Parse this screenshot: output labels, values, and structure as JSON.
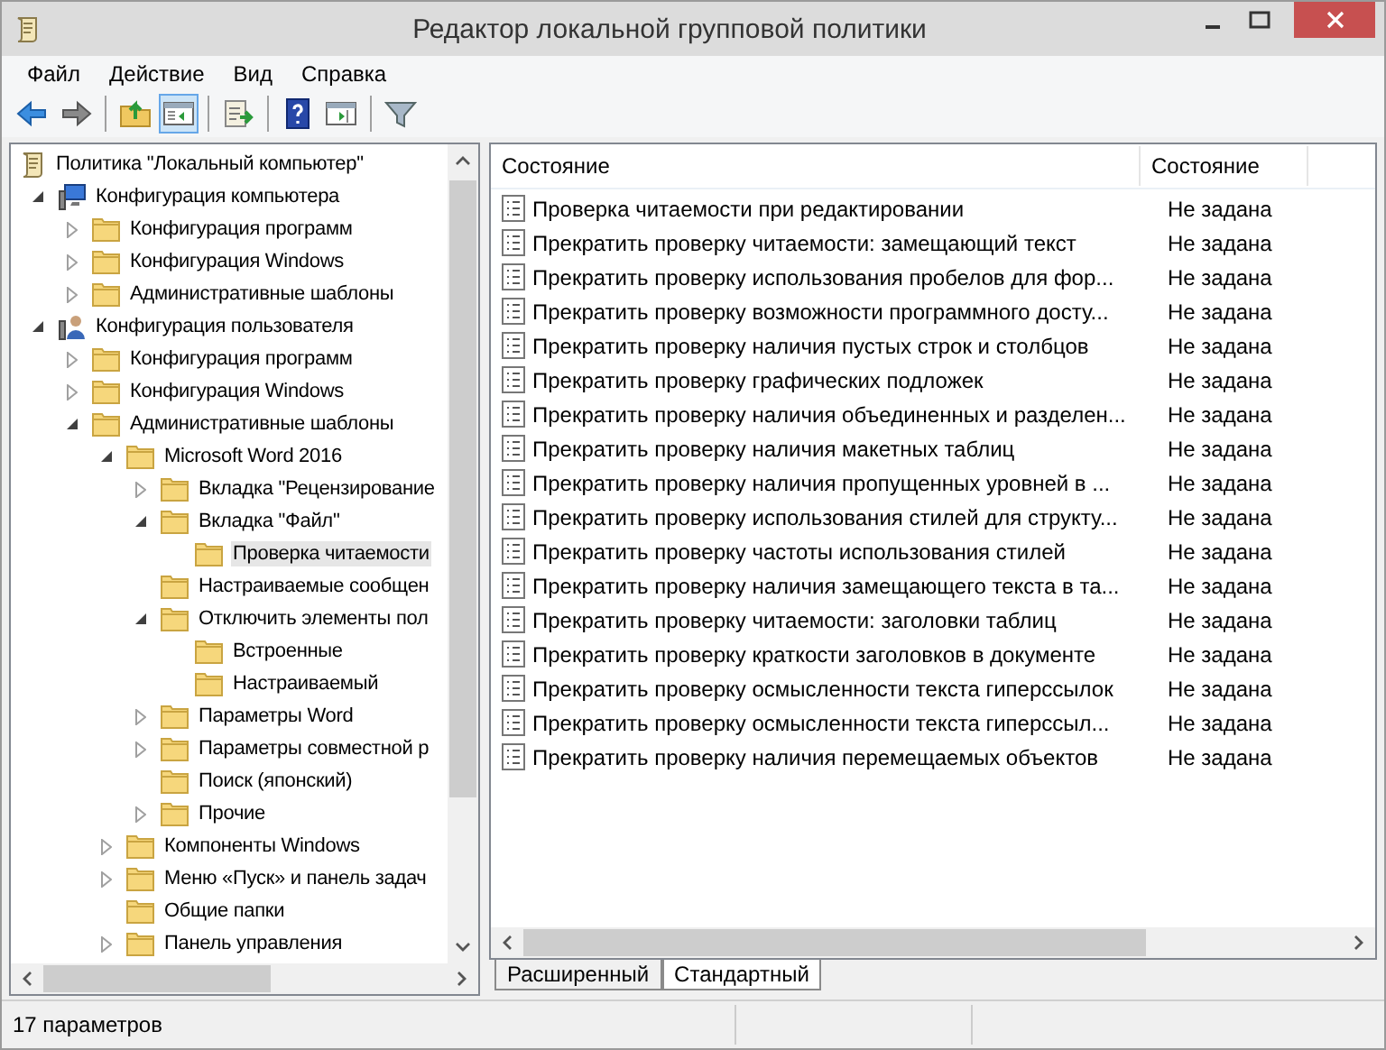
{
  "window": {
    "title": "Редактор локальной групповой политики"
  },
  "menu": [
    "Файл",
    "Действие",
    "Вид",
    "Справка"
  ],
  "toolbar": [
    [
      {
        "kind": "back",
        "pressed": false
      },
      {
        "kind": "forward",
        "pressed": false
      }
    ],
    [
      {
        "kind": "up",
        "pressed": false
      },
      {
        "kind": "tree",
        "pressed": true
      }
    ],
    [
      {
        "kind": "export",
        "pressed": false
      }
    ],
    [
      {
        "kind": "help",
        "pressed": false
      },
      {
        "kind": "pane",
        "pressed": false
      }
    ],
    [
      {
        "kind": "filter",
        "pressed": false
      }
    ]
  ],
  "tree": [
    {
      "label": "Политика \"Локальный компьютер\"",
      "kind": "policy",
      "selected": false,
      "children": [
        {
          "label": "Конфигурация компьютера",
          "kind": "computer",
          "expanded": true,
          "selected": false,
          "children": [
            {
              "label": "Конфигурация программ",
              "kind": "folder",
              "expanded": false,
              "selected": false
            },
            {
              "label": "Конфигурация Windows",
              "kind": "folder",
              "expanded": false,
              "selected": false
            },
            {
              "label": "Административные шаблоны",
              "kind": "folder",
              "expanded": false,
              "selected": false
            }
          ]
        },
        {
          "label": "Конфигурация пользователя",
          "kind": "user",
          "expanded": true,
          "selected": false,
          "children": [
            {
              "label": "Конфигурация программ",
              "kind": "folder",
              "expanded": false,
              "selected": false
            },
            {
              "label": "Конфигурация Windows",
              "kind": "folder",
              "expanded": false,
              "selected": false
            },
            {
              "label": "Административные шаблоны",
              "kind": "folder",
              "expanded": true,
              "selected": false,
              "children": [
                {
                  "label": "Microsoft Word 2016",
                  "kind": "folder",
                  "expanded": true,
                  "selected": false,
                  "children": [
                    {
                      "label": "Вкладка \"Рецензирование",
                      "kind": "folder",
                      "expanded": false,
                      "selected": false
                    },
                    {
                      "label": "Вкладка \"Файл\"",
                      "kind": "folder",
                      "expanded": true,
                      "selected": false,
                      "children": [
                        {
                          "label": "Проверка читаемости",
                          "kind": "folder",
                          "selected": true
                        }
                      ]
                    },
                    {
                      "label": "Настраиваемые сообщен",
                      "kind": "folder",
                      "selected": false
                    },
                    {
                      "label": "Отключить элементы пол",
                      "kind": "folder",
                      "expanded": true,
                      "selected": false,
                      "children": [
                        {
                          "label": "Встроенные",
                          "kind": "folder",
                          "selected": false
                        },
                        {
                          "label": "Настраиваемый",
                          "kind": "folder",
                          "selected": false
                        }
                      ]
                    },
                    {
                      "label": "Параметры Word",
                      "kind": "folder",
                      "expanded": false,
                      "selected": false
                    },
                    {
                      "label": "Параметры совместной р",
                      "kind": "folder",
                      "expanded": false,
                      "selected": false
                    },
                    {
                      "label": "Поиск (японский)",
                      "kind": "folder",
                      "selected": false
                    },
                    {
                      "label": "Прочие",
                      "kind": "folder",
                      "expanded": false,
                      "selected": false
                    }
                  ]
                },
                {
                  "label": "Компоненты Windows",
                  "kind": "folder",
                  "expanded": false,
                  "selected": false
                },
                {
                  "label": "Меню «Пуск» и панель задач",
                  "kind": "folder",
                  "expanded": false,
                  "selected": false
                },
                {
                  "label": "Общие папки",
                  "kind": "folder",
                  "selected": false
                },
                {
                  "label": "Панель управления",
                  "kind": "folder",
                  "expanded": false,
                  "selected": false
                }
              ]
            }
          ]
        }
      ]
    }
  ],
  "table": {
    "columns": [
      "Состояние",
      "Состояние"
    ],
    "rows": [
      [
        "Проверка читаемости при редактировании",
        "Не задана"
      ],
      [
        "Прекратить проверку читаемости: замещающий текст",
        "Не задана"
      ],
      [
        "Прекратить проверку использования пробелов для фор...",
        "Не задана"
      ],
      [
        "Прекратить проверку возможности программного досту...",
        "Не задана"
      ],
      [
        "Прекратить проверку наличия пустых строк и столбцов",
        "Не задана"
      ],
      [
        "Прекратить проверку графических подложек",
        "Не задана"
      ],
      [
        "Прекратить проверку наличия объединенных и разделен...",
        "Не задана"
      ],
      [
        "Прекратить проверку наличия макетных таблиц",
        "Не задана"
      ],
      [
        "Прекратить проверку наличия пропущенных уровней в ...",
        "Не задана"
      ],
      [
        "Прекратить проверку использования стилей для структу...",
        "Не задана"
      ],
      [
        "Прекратить проверку частоты использования стилей",
        "Не задана"
      ],
      [
        "Прекратить проверку наличия замещающего текста в та...",
        "Не задана"
      ],
      [
        "Прекратить проверку читаемости: заголовки таблиц",
        "Не задана"
      ],
      [
        "Прекратить проверку краткости заголовков в документе",
        "Не задана"
      ],
      [
        "Прекратить проверку осмысленности текста гиперссылок",
        "Не задана"
      ],
      [
        "Прекратить проверку осмысленности текста гиперссыл...",
        "Не задана"
      ],
      [
        "Прекратить проверку наличия перемещаемых объектов",
        "Не задана"
      ]
    ]
  },
  "tabs": [
    {
      "label": "Расширенный",
      "selected": false
    },
    {
      "label": "Стандартный",
      "selected": true
    }
  ],
  "status_bar": "17 параметров"
}
